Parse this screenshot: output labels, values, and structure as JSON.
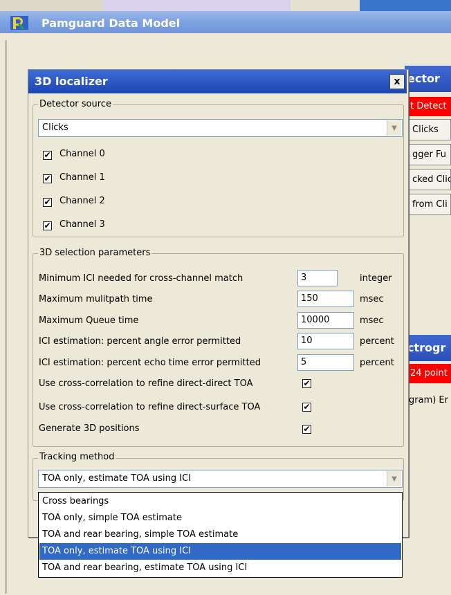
{
  "app": {
    "window_title": "Pamguard Data Model"
  },
  "background_panels": {
    "panel1_title": "ector",
    "panel1_red": "t Detect",
    "panel1_buttons": [
      "Clicks",
      "gger Fu",
      "cked Clic",
      "from Cli"
    ],
    "panel2_title": "ctrogr",
    "panel2_red": "24 point",
    "panel2_text": "gram) Er"
  },
  "dialog": {
    "title": "3D localizer",
    "close_label": "x",
    "detector_source": {
      "legend": "Detector source",
      "selected": "Clicks",
      "channels": [
        {
          "label": "Channel 0",
          "checked": "✔"
        },
        {
          "label": "Channel 1",
          "checked": "✔"
        },
        {
          "label": "Channel 2",
          "checked": "✔"
        },
        {
          "label": "Channel 3",
          "checked": "✔"
        }
      ]
    },
    "selection_params": {
      "legend": "3D selection parameters",
      "rows": [
        {
          "label": "Minimum ICI needed for cross-channel match",
          "value": "3",
          "unit": "integer"
        },
        {
          "label": "Maximum mulitpath time",
          "value": "150",
          "unit": "msec"
        },
        {
          "label": "Maximum Queue time",
          "value": "10000",
          "unit": "msec"
        },
        {
          "label": "ICI estimation: percent angle error permitted",
          "value": "10",
          "unit": "percent"
        },
        {
          "label": "ICI estimation: percent echo time error permitted",
          "value": "5",
          "unit": "percent"
        }
      ],
      "checks": [
        {
          "label": "Use cross-correlation to refine direct-direct TOA",
          "checked": "✔"
        },
        {
          "label": "Use cross-correlation to refine direct-surface TOA",
          "checked": "✔"
        },
        {
          "label": "Generate 3D positions",
          "checked": "✔"
        }
      ]
    },
    "tracking": {
      "legend": "Tracking method",
      "selected": "TOA only, estimate TOA using ICI",
      "options": [
        "Cross bearings",
        "TOA only, simple TOA estimate",
        "TOA and rear bearing, simple TOA estimate",
        "TOA only, estimate TOA using ICI",
        "TOA and rear bearing, estimate TOA using ICI"
      ]
    }
  },
  "colors": {
    "title_blue": "#1d46b4",
    "selection_blue": "#316ac5",
    "alert_red": "#ff0000"
  }
}
